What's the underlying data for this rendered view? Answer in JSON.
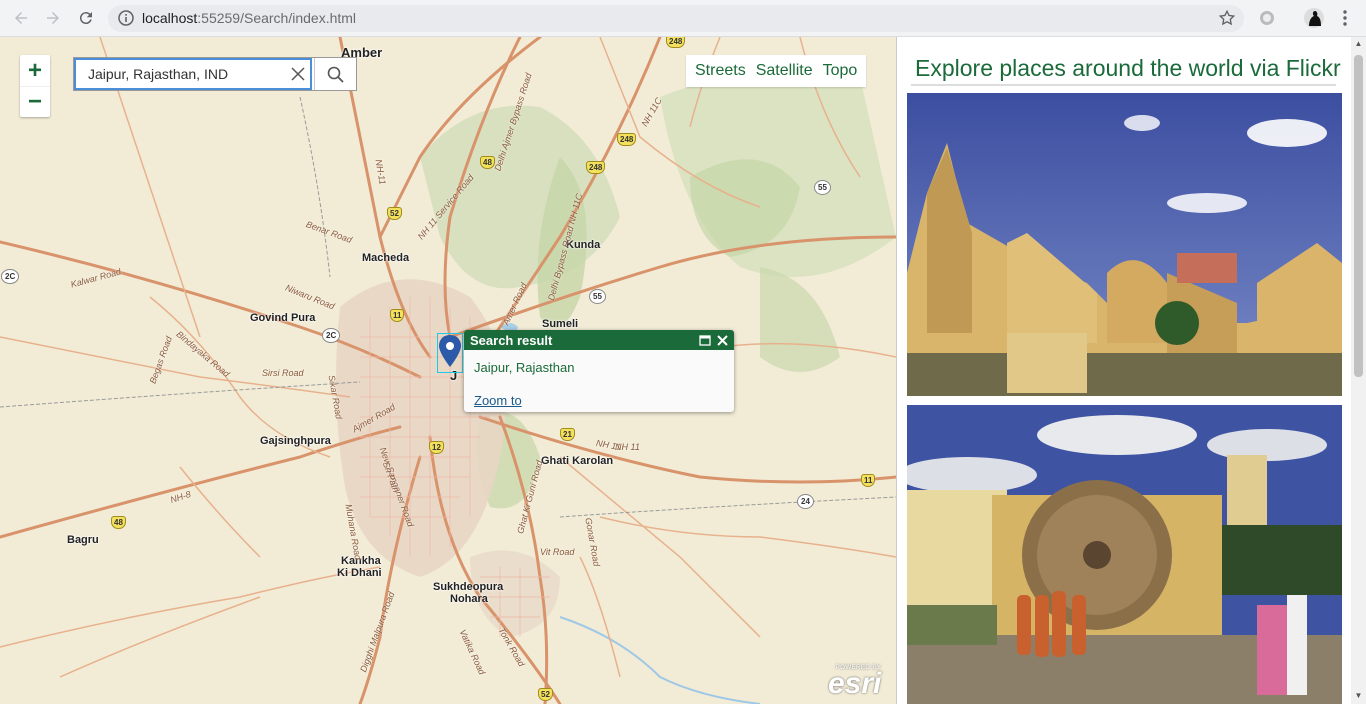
{
  "browser": {
    "url_host": "localhost",
    "url_path": ":55259/Search/index.html"
  },
  "map": {
    "search": {
      "value": "Jaipur, Rajasthan, IND"
    },
    "zoom": {
      "in_label": "+",
      "out_label": "−"
    },
    "basemaps": [
      "Streets",
      "Satellite",
      "Topo"
    ],
    "places": {
      "amber": "Amber",
      "macheda": "Macheda",
      "kunda": "Kunda",
      "govind_pura": "Govind Pura",
      "sumeli": "Sumeli",
      "gajsinghpura": "Gajsinghpura",
      "ghati_karolan": "Ghati Karolan",
      "bagru": "Bagru",
      "kankha": "Kankha",
      "ki_dhani": "Ki Dhani",
      "sukhdeopura": "Sukhdeopura",
      "nohara": "Nohara",
      "j_partial": "J"
    },
    "roads": {
      "kalwar": "Kalwar Road",
      "niwaru": "Niwaru Road",
      "bindayaka": "Bindayaka Road",
      "begas": "Begas Road",
      "sirsi": "Sirsi Road",
      "ajmer": "Ajmer Road",
      "benar": "Benar Road",
      "nh11_service": "NH 11 Service Road",
      "delhi_ajmer": "Delhi Ajmer Bypass Road",
      "delhi_bypass": "Delhi Bypass Road NH 11C",
      "amer": "Amer Road",
      "nh11c_top": "NH 11C",
      "nh11_label": "NH-11",
      "nh11_right": "NH 11",
      "nh8": "NH-8",
      "vit": "Vit Road",
      "gonar": "Gonar Road",
      "tonk": "Tonk Road",
      "vatika": "Vatika Road",
      "digghi": "Digghi Malpura Road",
      "muhana": "Muhana Road",
      "new_sanganer": "New Sanganer Road",
      "sikar": "Sikar Road",
      "nh11_vert": "NH 11",
      "ghat_ki": "Ghat Ki Guni Road",
      "shripath": "Sri Path"
    },
    "shields": {
      "s248a": "248",
      "s248b": "248",
      "s248c": "248",
      "s48a": "48",
      "s52a": "52",
      "s55a": "55",
      "s55b": "55",
      "s11": "11",
      "s2c_a": "2C",
      "s2c_b": "2C",
      "s12": "12",
      "s21": "21",
      "s24": "24",
      "s11b": "11",
      "s48b": "48",
      "s52b": "52"
    },
    "popup": {
      "title": "Search result",
      "body": "Jaipur, Rajasthan",
      "link": "Zoom to"
    },
    "attribution": {
      "small": "POWERED BY",
      "big": "esri"
    }
  },
  "panel": {
    "title": "Explore places around the world via Flickr"
  },
  "colors": {
    "accent": "#1b6a3a",
    "search_border": "#4a8fd7"
  },
  "icons": [
    "back-icon",
    "forward-icon",
    "reload-icon",
    "info-icon",
    "star-icon",
    "search-icon",
    "clear-icon",
    "map-pin-icon",
    "maximize-icon",
    "close-icon"
  ]
}
